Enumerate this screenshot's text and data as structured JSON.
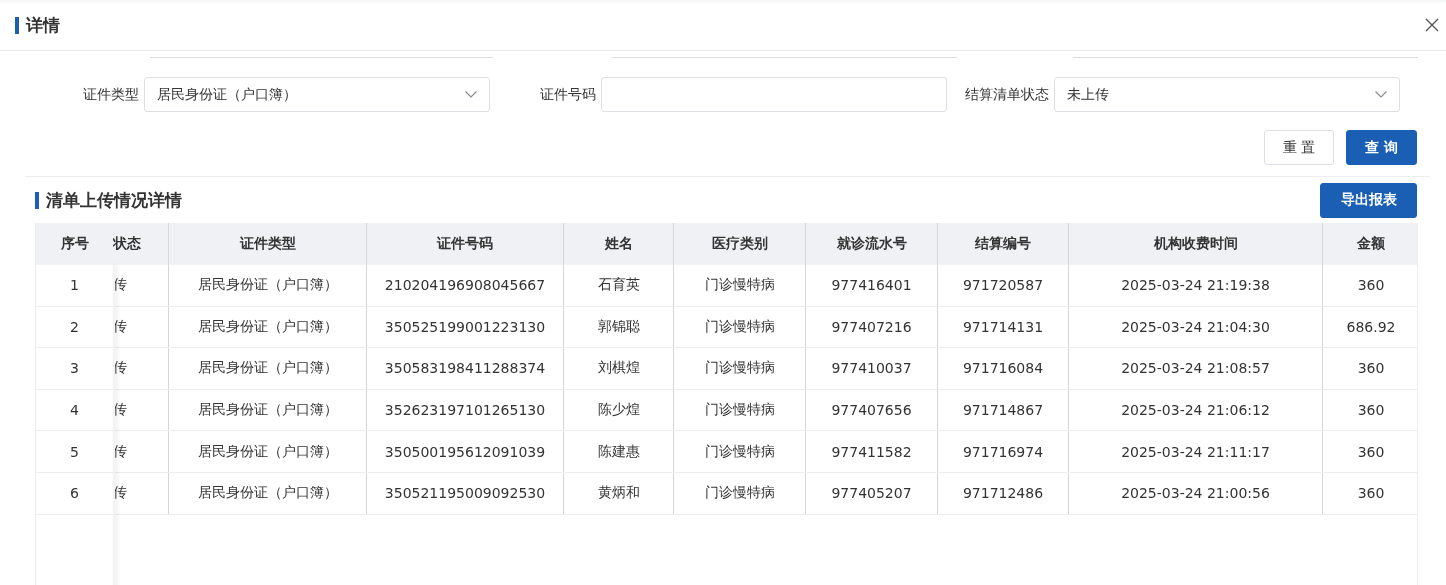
{
  "dialog": {
    "title": "详情"
  },
  "filters": [
    {
      "kind": "select",
      "label": "证件类型",
      "value": "居民身份证（户口簿）"
    },
    {
      "kind": "input",
      "label": "证件号码"
    },
    {
      "kind": "select",
      "label": "结算清单状态",
      "value": "未上传"
    }
  ],
  "buttons": [
    {
      "kind": "plain",
      "label": "重 置"
    },
    {
      "kind": "primary",
      "label": "查 询"
    }
  ],
  "section": {
    "title": "清单上传情况详情",
    "export_button": "导出报表"
  },
  "table": {
    "columns": [
      "序号",
      "状态",
      "证件类型",
      "证件号码",
      "姓名",
      "医疗类别",
      "就诊流水号",
      "结算编号",
      "机构收费时间",
      "金额"
    ],
    "rows": [
      [
        "1",
        "传",
        "居民身份证（户口簿）",
        "210204196908045667",
        "石育英",
        "门诊慢特病",
        "977416401",
        "971720587",
        "2025-03-24 21:19:38",
        "360"
      ],
      [
        "2",
        "传",
        "居民身份证（户口簿）",
        "350525199001223130",
        "郭锦聪",
        "门诊慢特病",
        "977407216",
        "971714131",
        "2025-03-24 21:04:30",
        "686.92"
      ],
      [
        "3",
        "传",
        "居民身份证（户口簿）",
        "350583198411288374",
        "刘棋煌",
        "门诊慢特病",
        "977410037",
        "971716084",
        "2025-03-24 21:08:57",
        "360"
      ],
      [
        "4",
        "传",
        "居民身份证（户口簿）",
        "352623197101265130",
        "陈少煌",
        "门诊慢特病",
        "977407656",
        "971714867",
        "2025-03-24 21:06:12",
        "360"
      ],
      [
        "5",
        "传",
        "居民身份证（户口簿）",
        "350500195612091039",
        "陈建惠",
        "门诊慢特病",
        "977411582",
        "971716974",
        "2025-03-24 21:11:17",
        "360"
      ],
      [
        "6",
        "传",
        "居民身份证（户口簿）",
        "350521195009092530",
        "黄炳和",
        "门诊慢特病",
        "977405207",
        "971712486",
        "2025-03-24 21:00:56",
        "360"
      ]
    ]
  }
}
